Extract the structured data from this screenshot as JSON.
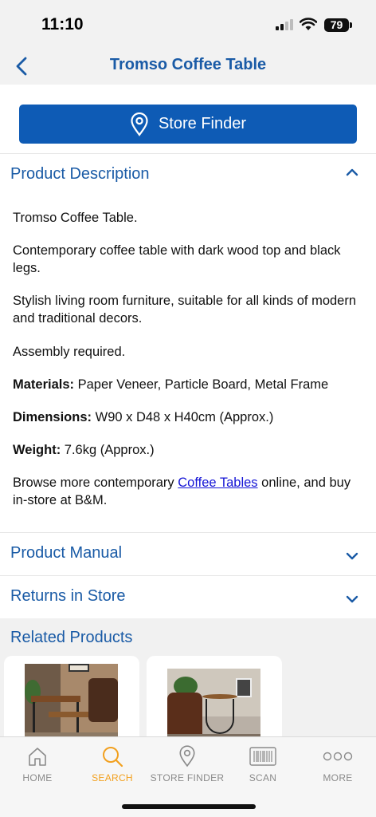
{
  "status_bar": {
    "time": "11:10",
    "battery": "79"
  },
  "header": {
    "title": "Tromso Coffee Table"
  },
  "store_finder": {
    "label": "Store Finder"
  },
  "product_description": {
    "title": "Product Description",
    "expanded": true,
    "paragraphs": {
      "p1": "Tromso Coffee Table.",
      "p2": "Contemporary coffee table with dark wood top and black legs.",
      "p3": "Stylish living room furniture, suitable for all kinds of modern and traditional decors.",
      "p4": "Assembly required."
    },
    "materials": {
      "label": "Materials:",
      "value": "Paper Veneer, Particle Board, Metal Frame"
    },
    "dimensions": {
      "label": "Dimensions:",
      "value": "W90 x D48 x H40cm (Approx.)"
    },
    "weight": {
      "label": "Weight:",
      "value": "7.6kg (Approx.)"
    },
    "browse": {
      "before": "Browse more contemporary ",
      "link": "Coffee Tables",
      "after": " online, and buy in-store at B&M."
    }
  },
  "product_manual": {
    "title": "Product Manual"
  },
  "returns": {
    "title": "Returns in Store"
  },
  "related": {
    "title": "Related Products"
  },
  "tabs": [
    {
      "label": "HOME",
      "icon": "home-icon"
    },
    {
      "label": "SEARCH",
      "icon": "search-icon",
      "active": true
    },
    {
      "label": "STORE FINDER",
      "icon": "location-pin-icon"
    },
    {
      "label": "SCAN",
      "icon": "barcode-icon"
    },
    {
      "label": "MORE",
      "icon": "more-icon"
    }
  ],
  "colors": {
    "brand_blue": "#0e5bb5",
    "link_blue": "#1a5ba6",
    "active_tab": "#f2a01e"
  }
}
